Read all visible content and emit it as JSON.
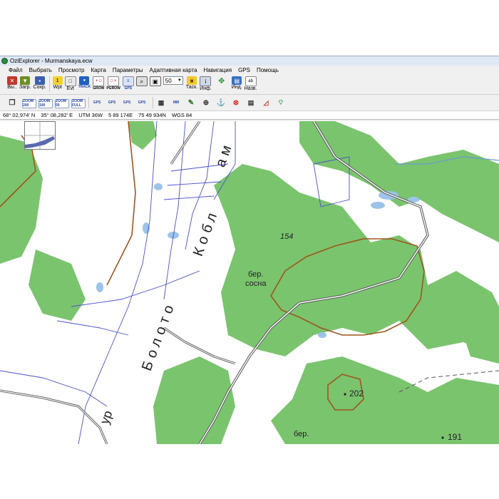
{
  "window": {
    "title": "OziExplorer - Murmanskaya.ecw"
  },
  "menu": [
    "Файл",
    "Выбрать",
    "Просмотр",
    "Карта",
    "Параметры",
    "Адаптивная карта",
    "Навигация",
    "GPS",
    "Помощь"
  ],
  "toolbar1": {
    "exit": "Вы..",
    "load": "Загр.",
    "save": "Сохр.",
    "wpt": "Wpt",
    "evt": "Evt",
    "track": "TRACK",
    "grow": "GROW",
    "pgrow": "PGROW",
    "gps_snap": "GPS",
    "zoom": "50",
    "task": "Таск.",
    "info": "Инф.",
    "ind": "Инд.",
    "nav": "Назв."
  },
  "toolbar2": {
    "zoom200": "ZOOM 200",
    "zoom100": "ZOOM 100",
    "zoom50": "ZOOM 50",
    "zoomfull": "ZOOM FULL",
    "btn_gps1": "GPS",
    "btn_gps2": "GPS",
    "btn_gps3": "GPS",
    "btn_gps4": "GPS",
    "btn_mm": "MM"
  },
  "status": {
    "lat": "68° 02,974' N",
    "lon": "35° 08,282' E",
    "utm": "UTM  36W",
    "easting": "5 89 174E",
    "northing": "75 49 934N",
    "datum": "WGS 84"
  },
  "map": {
    "labels": {
      "h154": "154",
      "ber1": "бер.",
      "sosna": "сосна",
      "h202": "202",
      "ber2": "бер.",
      "h191": "191",
      "uroch": "ур",
      "boloto": "Болото",
      "kobl": "Кобл",
      "am": "ам"
    }
  },
  "colors": {
    "forest": "#7ac46e",
    "water": "#9cc3ea",
    "contour": "#a0541e",
    "road": "#555555",
    "swamp_lines": "#4a50c8"
  }
}
